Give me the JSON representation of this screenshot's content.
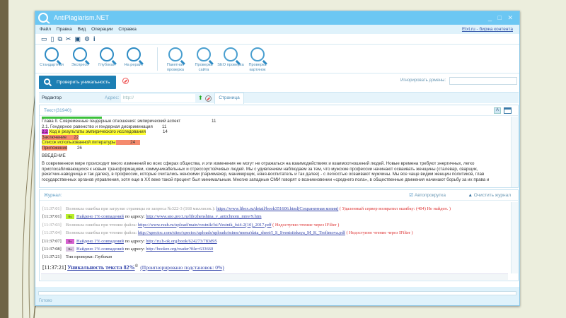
{
  "window": {
    "title": "AntiPlagiarism.NET",
    "controls": "_ □ ✕"
  },
  "menu": {
    "items": [
      "Файл",
      "Правка",
      "Вид",
      "Операции",
      "Справка"
    ],
    "external_link": "Etxt.ru - биржа контента"
  },
  "icon_toolbar": [
    "folder-open",
    "new-file",
    "copy",
    "cut",
    "paste",
    "settings",
    "info"
  ],
  "tools": {
    "left": [
      {
        "label": "Стандартная"
      },
      {
        "label": "Экспресс"
      },
      {
        "label": "Глубокая"
      },
      {
        "label": "На рерайт"
      }
    ],
    "right": [
      {
        "label": "Пакетная проверка"
      },
      {
        "label": "Проверка сайта"
      },
      {
        "label": "SEO проверка"
      },
      {
        "label": "Проверка картинок"
      }
    ]
  },
  "actions": {
    "check_label": "Проверить уникальность",
    "ignore_domains_label": "Игнорировать домены:",
    "ignore_domains_value": ""
  },
  "editor": {
    "tab_label": "Редактор",
    "address_label": "Адрес:",
    "address_placeholder": "http://",
    "page_tab": "Страница"
  },
  "text_panel": {
    "header": "Текст(31940):",
    "toc": [
      {
        "parts": [
          "Глава II. Современные гендерные отношения: эмпирический аспект",
          "11"
        ]
      },
      {
        "parts": [
          "2.1. Гендерное равенство и гендерная дискриминация",
          "11"
        ]
      },
      {
        "parts": [
          "2.2",
          "Ход и результаты эмпирического исследования",
          "14"
        ]
      },
      {
        "parts": [
          "Заключение",
          "22"
        ]
      },
      {
        "parts": [
          "Список использованной литературы",
          "24"
        ]
      },
      {
        "parts": [
          "Приложения",
          "26"
        ]
      }
    ],
    "heading": "ВВЕДЕНИЕ",
    "paragraph_lines": [
      "В современном мире происходит много изменений во всех сферах общества, и эти изменения не могут не отражаться на взаимодействиях и взаимоотношений людей.  Новые времена требуют энергичных, легко",
      "приспосабливающихся к новым трансформациям, коммуникабельных и стрессоустойчивых людей.  Мы с удивлением наблюдаем за тем, что мужские профессии начинают осваивать женщины (сталевар, сварщик,",
      "рекетчик-наводчица и так далее), в профессии, которые считались женскими (парикмахер, маникюрщик, няня-воспитатель и так далее) - с легкостью осваивают мужчины. Мы все чаще видим женщин политиков, глав",
      "государственных органов управления, хотя еще в XX веке такой процент был минимальным. Многие западные СМИ говорят о возникновении «среднего пола», в общественные движения начинают борьбу за их права и"
    ]
  },
  "journal": {
    "header": "Журнал:",
    "autoscroll_label": "Автопрокрутка",
    "autoscroll_checked": true,
    "clear_label": "Очистить журнал",
    "badge_text": "Ru",
    "entries": [
      {
        "time": "[11:37:01]",
        "gray": true,
        "text": "Возникла ошибка при загрузке страницы из запроса №322-3 (168 миллисек.):",
        "link": "https://www.libex.ru/detail/book351606.html(Сохраненная копия)",
        "error": "( Удаленный сервер возвратил ошибку: (404) Не найден. )"
      },
      {
        "time": "[11:37:01]",
        "badge": "#b8ef2a",
        "found": "Найдено 1% совпадений",
        "text": "по адресу:",
        "link": "http://www.sno.pro1.ru/lib/zhenshina_v_antichnom_mire/9.htm"
      },
      {
        "time": "[11:37:03]",
        "gray": true,
        "text": "Возникла ошибка при чтении файла:",
        "link": "https://www.rsuh.ru/upload/main/vestnik/fsi/Vestnik_fsi4-2(10)_2017.pdf",
        "error": "( Недоступно чтение через IFilter )"
      },
      {
        "time": "[11:37:04]",
        "gray": true,
        "text": "Возникла ошибка при чтении файла:",
        "link": "http://xpectoc.com/sites/xpectoc/uploads/uploads/mime/menu/data_sheet/I_S_Sventsitskaya_M_K_Trofimova.pdf",
        "error": "( Недоступно чтение через IFilter )"
      },
      {
        "time": "[11:37:07]",
        "badge": "#d760d0",
        "found": "Найдено 1% совпадений",
        "text": "по адресу:",
        "link": "http://ru.b-ok.org/book/624273/783d95"
      },
      {
        "time": "[11:37:08]",
        "badge": "#d8c6e0",
        "found": "Найдено 1% совпадений",
        "text": "по адресу:",
        "link": "http://bookre.org/reader?file=633660"
      },
      {
        "time": "[11:37:21]",
        "text": "Тип проверки:",
        "italic": "Глубокая"
      }
    ],
    "result": {
      "time": "[11:37:21]",
      "uniqueness": "Уникальность текста 82%",
      "mark": "©",
      "ignored": "(Проигнорировано подстановок: 0%)"
    }
  },
  "status": {
    "text": "Готово",
    "progress": 0
  }
}
